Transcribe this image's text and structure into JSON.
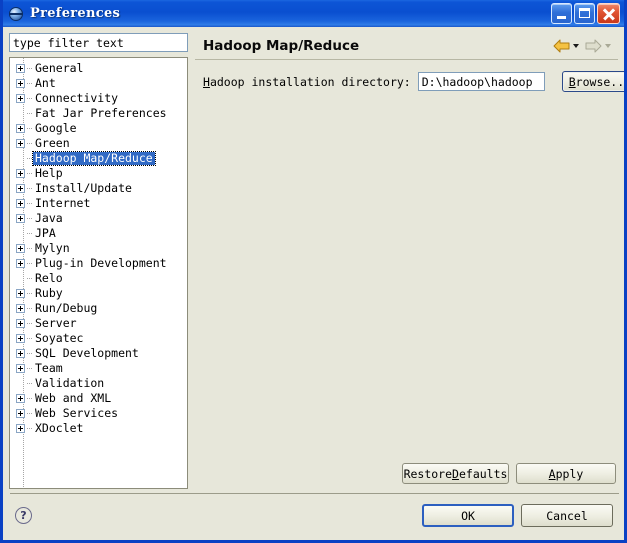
{
  "window": {
    "title": "Preferences",
    "icon": "preferences-globe-icon",
    "minimize_label": "Minimize",
    "maximize_label": "Maximize",
    "close_label": "Close",
    "accent_color": "#0a41c4",
    "background_color": "#e7e7da"
  },
  "filter": {
    "value": "type filter text",
    "placeholder": "type filter text"
  },
  "tree": {
    "selected": "Hadoop Map/Reduce",
    "selection_color": "#316ac5",
    "items": [
      {
        "label": "General",
        "expandable": true
      },
      {
        "label": "Ant",
        "expandable": true
      },
      {
        "label": "Connectivity",
        "expandable": true
      },
      {
        "label": "Fat Jar Preferences",
        "expandable": false
      },
      {
        "label": "Google",
        "expandable": true
      },
      {
        "label": "Green",
        "expandable": true
      },
      {
        "label": "Hadoop Map/Reduce",
        "expandable": false,
        "selected": true
      },
      {
        "label": "Help",
        "expandable": true
      },
      {
        "label": "Install/Update",
        "expandable": true
      },
      {
        "label": "Internet",
        "expandable": true
      },
      {
        "label": "Java",
        "expandable": true
      },
      {
        "label": "JPA",
        "expandable": false
      },
      {
        "label": "Mylyn",
        "expandable": true
      },
      {
        "label": "Plug-in Development",
        "expandable": true
      },
      {
        "label": "Relo",
        "expandable": false
      },
      {
        "label": "Ruby",
        "expandable": true
      },
      {
        "label": "Run/Debug",
        "expandable": true
      },
      {
        "label": "Server",
        "expandable": true
      },
      {
        "label": "Soyatec",
        "expandable": true
      },
      {
        "label": "SQL Development",
        "expandable": true
      },
      {
        "label": "Team",
        "expandable": true
      },
      {
        "label": "Validation",
        "expandable": false
      },
      {
        "label": "Web and XML",
        "expandable": true
      },
      {
        "label": "Web Services",
        "expandable": true
      },
      {
        "label": "XDoclet",
        "expandable": true
      }
    ]
  },
  "page": {
    "title": "Hadoop Map/Reduce",
    "nav": {
      "back_label": "Back",
      "back_color": "#e8a317",
      "back_enabled": true,
      "forward_label": "Forward",
      "forward_color": "#c9c9b8",
      "forward_enabled": false
    },
    "field": {
      "label_prefix": "H",
      "label_rest": "adoop installation directory:",
      "value": "D:\\hadoop\\hadoop",
      "browse_prefix": "B",
      "browse_rest": "rowse..."
    },
    "restore_defaults": {
      "prefix": "Restore ",
      "mnemonic": "D",
      "rest": "efaults"
    },
    "apply": {
      "prefix": "",
      "mnemonic": "A",
      "rest": "pply"
    }
  },
  "footer": {
    "help_icon": "help-question-icon",
    "help_label": "?",
    "ok_label": "OK",
    "cancel_label": "Cancel"
  }
}
